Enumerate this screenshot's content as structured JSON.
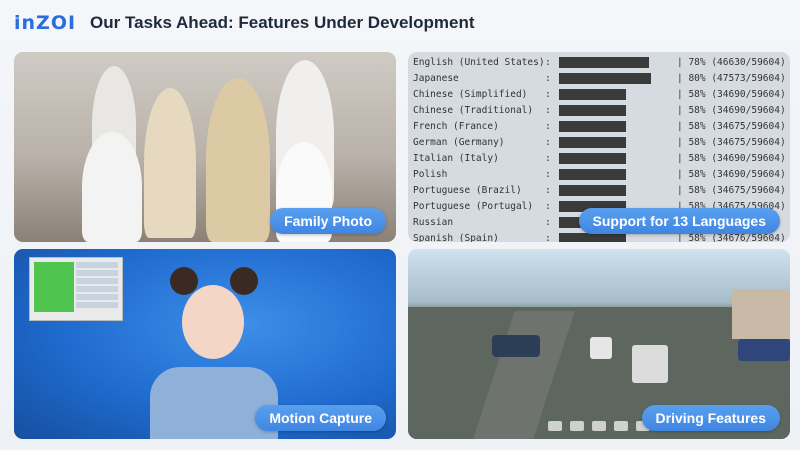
{
  "header": {
    "logo": "inZOI",
    "title": "Our Tasks Ahead: Features Under Development"
  },
  "panels": {
    "family": {
      "caption": "Family Photo"
    },
    "languages": {
      "caption": "Support for 13 Languages",
      "rows": [
        {
          "name": "English (United States)",
          "pct": "78% (46630/59604)",
          "fill": 0.78
        },
        {
          "name": "Japanese",
          "pct": "80% (47573/59604)",
          "fill": 0.8
        },
        {
          "name": "Chinese (Simplified)",
          "pct": "58% (34690/59604)",
          "fill": 0.58
        },
        {
          "name": "Chinese (Traditional)",
          "pct": "58% (34690/59604)",
          "fill": 0.58
        },
        {
          "name": "French (France)",
          "pct": "58% (34675/59604)",
          "fill": 0.58
        },
        {
          "name": "German (Germany)",
          "pct": "58% (34675/59604)",
          "fill": 0.58
        },
        {
          "name": "Italian (Italy)",
          "pct": "58% (34690/59604)",
          "fill": 0.58
        },
        {
          "name": "Polish",
          "pct": "58% (34690/59604)",
          "fill": 0.58
        },
        {
          "name": "Portuguese (Brazil)",
          "pct": "58% (34675/59604)",
          "fill": 0.58
        },
        {
          "name": "Portuguese (Portugal)",
          "pct": "58% (34675/59604)",
          "fill": 0.58
        },
        {
          "name": "Russian",
          "pct": "",
          "fill": 0.58
        },
        {
          "name": "Spanish (Spain)",
          "pct": "58% (34676/59604)",
          "fill": 0.58
        }
      ]
    },
    "mocap": {
      "caption": "Motion Capture"
    },
    "driving": {
      "caption": "Driving Features"
    }
  }
}
